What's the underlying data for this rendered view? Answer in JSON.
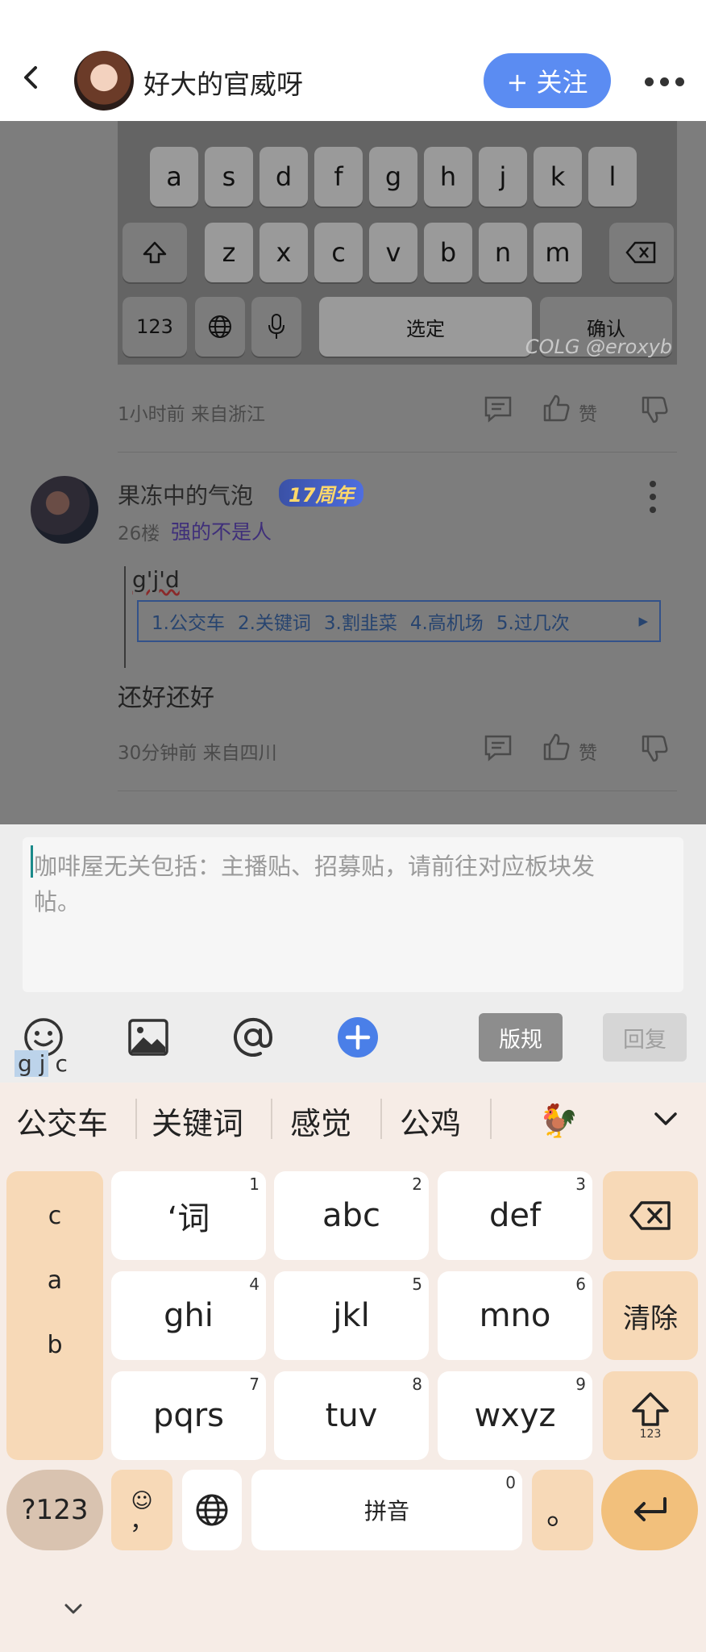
{
  "header": {
    "title": "好大的官威呀",
    "follow_label": "+ 关注"
  },
  "post1": {
    "keyboard_keys_row1": [
      "a",
      "s",
      "d",
      "f",
      "g",
      "h",
      "j",
      "k",
      "l"
    ],
    "keyboard_keys_row2": [
      "z",
      "x",
      "c",
      "v",
      "b",
      "n",
      "m"
    ],
    "kb_123": "123",
    "kb_select": "选定",
    "kb_confirm": "确认",
    "watermark": "COLG @eroxyb",
    "meta": "1小时前 来自浙江",
    "like": "赞"
  },
  "post2": {
    "username": "果冻中的气泡",
    "badge": "17周年",
    "floor": "26楼",
    "tag": "强的不是人",
    "typed": "g'j'd",
    "candidates": [
      "1.公交车",
      "2.关键词",
      "3.割韭菜",
      "4.高机场",
      "5.过几次"
    ],
    "body": "还好还好",
    "meta": "30分钟前 来自四川",
    "like": "赞"
  },
  "composer": {
    "placeholder_line1": "咖啡屋无关包括：主播贴、招募贴，请前往对应板块发",
    "placeholder_line2": "帖。",
    "rule_label": "版规",
    "reply_label": "回复",
    "composing_prefix": "g j",
    "composing_suffix": "c"
  },
  "ime": {
    "candidates": [
      "公交车",
      "关键词",
      "感觉",
      "公鸡"
    ],
    "emoji_candidate": "🐓",
    "left_letters": [
      "c",
      "a",
      "b"
    ],
    "keys": [
      {
        "label": "‘词",
        "num": "1"
      },
      {
        "label": "abc",
        "num": "2"
      },
      {
        "label": "def",
        "num": "3"
      },
      {
        "label": "ghi",
        "num": "4"
      },
      {
        "label": "jkl",
        "num": "5"
      },
      {
        "label": "mno",
        "num": "6"
      },
      {
        "label": "pqrs",
        "num": "7"
      },
      {
        "label": "tuv",
        "num": "8"
      },
      {
        "label": "wxyz",
        "num": "9"
      }
    ],
    "clear_label": "清除",
    "shift_sub": "123",
    "sym_label": "?123",
    "space_label": "拼音",
    "space_num": "0",
    "period": "。",
    "comma": "，"
  }
}
